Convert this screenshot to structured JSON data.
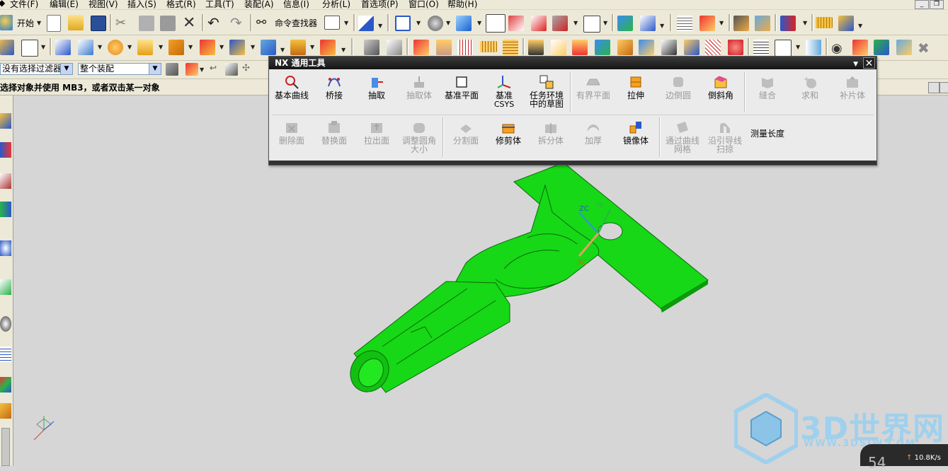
{
  "menubar": {
    "items": [
      "文件(F)",
      "编辑(E)",
      "视图(V)",
      "插入(S)",
      "格式(R)",
      "工具(T)",
      "装配(A)",
      "信息(I)",
      "分析(L)",
      "首选项(P)",
      "窗口(O)",
      "帮助(H)"
    ]
  },
  "toolbar": {
    "start_label": "开始",
    "command_finder_label": "命令查找器"
  },
  "selection_bar": {
    "filter_value": "没有选择过滤器",
    "scope_value": "整个装配"
  },
  "cue_line": {
    "text": "选择对象并使用 MB3，或者双击某一对象"
  },
  "palette": {
    "title": "NX 通用工具",
    "row1": [
      {
        "label": "基本曲线",
        "enabled": true,
        "icon": "basic-curves-icon"
      },
      {
        "label": "桥接",
        "enabled": true,
        "icon": "bridge-curve-icon"
      },
      {
        "label": "抽取",
        "enabled": true,
        "icon": "extract-icon"
      },
      {
        "label": "抽取体",
        "enabled": false,
        "icon": "extract-body-icon"
      },
      {
        "label": "基准平面",
        "enabled": true,
        "icon": "datum-plane-icon"
      },
      {
        "label": "基准CSYS",
        "line1": "基准",
        "line2": "CSYS",
        "enabled": true,
        "icon": "datum-csys-icon"
      },
      {
        "label": "任务环境中的草图",
        "line1": "任务环境",
        "line2": "中的草图",
        "enabled": true,
        "icon": "sketch-task-icon"
      },
      {
        "label": "有界平面",
        "enabled": false,
        "icon": "bounded-plane-icon"
      },
      {
        "label": "拉伸",
        "enabled": true,
        "icon": "extrude-icon"
      },
      {
        "label": "边倒圆",
        "enabled": false,
        "icon": "edge-blend-icon"
      },
      {
        "label": "倒斜角",
        "enabled": true,
        "icon": "chamfer-icon"
      },
      {
        "label": "缝合",
        "enabled": false,
        "icon": "sew-icon"
      },
      {
        "label": "求和",
        "enabled": false,
        "icon": "unite-icon"
      },
      {
        "label": "补片体",
        "enabled": false,
        "icon": "patch-body-icon"
      }
    ],
    "row2": [
      {
        "label": "删除面",
        "enabled": false,
        "icon": "delete-face-icon"
      },
      {
        "label": "替换面",
        "enabled": false,
        "icon": "replace-face-icon"
      },
      {
        "label": "拉出面",
        "enabled": false,
        "icon": "pull-face-icon"
      },
      {
        "label": "调整圆角大小",
        "line1": "调整圆角",
        "line2": "大小",
        "enabled": false,
        "icon": "resize-blend-icon"
      },
      {
        "label": "分割面",
        "enabled": false,
        "icon": "divide-face-icon"
      },
      {
        "label": "修剪体",
        "enabled": true,
        "icon": "trim-body-icon"
      },
      {
        "label": "拆分体",
        "enabled": false,
        "icon": "split-body-icon"
      },
      {
        "label": "加厚",
        "enabled": false,
        "icon": "thicken-icon"
      },
      {
        "label": "镜像体",
        "enabled": true,
        "icon": "mirror-body-icon"
      },
      {
        "label": "通过曲线网格",
        "line1": "通过曲线",
        "line2": "网格",
        "enabled": false,
        "icon": "through-curve-mesh-icon"
      },
      {
        "label": "沿引导线扫掠",
        "line1": "沿引导线",
        "line2": "扫掠",
        "enabled": false,
        "icon": "sweep-along-guide-icon"
      }
    ],
    "measure_length_label": "测量长度"
  },
  "viewport": {
    "wcs_labels": {
      "zc": "ZC",
      "yc": "YC",
      "xc": "XC"
    },
    "model_color": "#16d816",
    "model_edge_color": "#0a6a0a"
  },
  "watermark": {
    "brand": "3D世界网",
    "url": "WWW.3DSJW.COM"
  },
  "status_widget": {
    "number": "54",
    "rate": "10.8K/s"
  },
  "colors": {
    "toolbar_bg": "#ece9d8",
    "graphics_bg": "#d6d6d6",
    "palette_title_bg": "#1e1e1e"
  }
}
